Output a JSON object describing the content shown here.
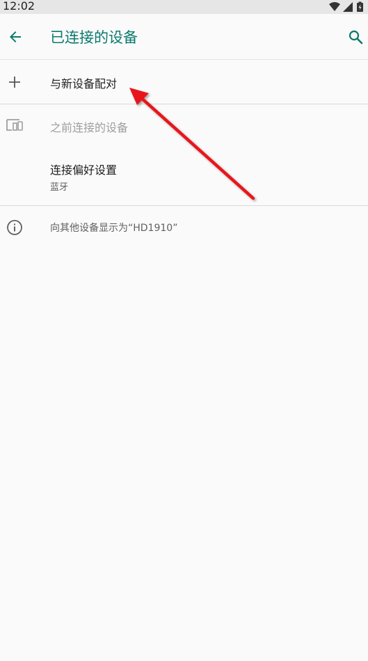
{
  "status_bar": {
    "time": "12:02"
  },
  "app_bar": {
    "title": "已连接的设备"
  },
  "rows": {
    "pair_new": {
      "label": "与新设备配对"
    },
    "previous": {
      "label": "之前连接的设备"
    },
    "preferences": {
      "label": "连接偏好设置",
      "subtitle": "蓝牙"
    }
  },
  "footer": {
    "visibility_text": "向其他设备显示为“HD1910”"
  },
  "colors": {
    "accent": "#0a7a6c",
    "annotation_arrow": "#e8141b"
  }
}
